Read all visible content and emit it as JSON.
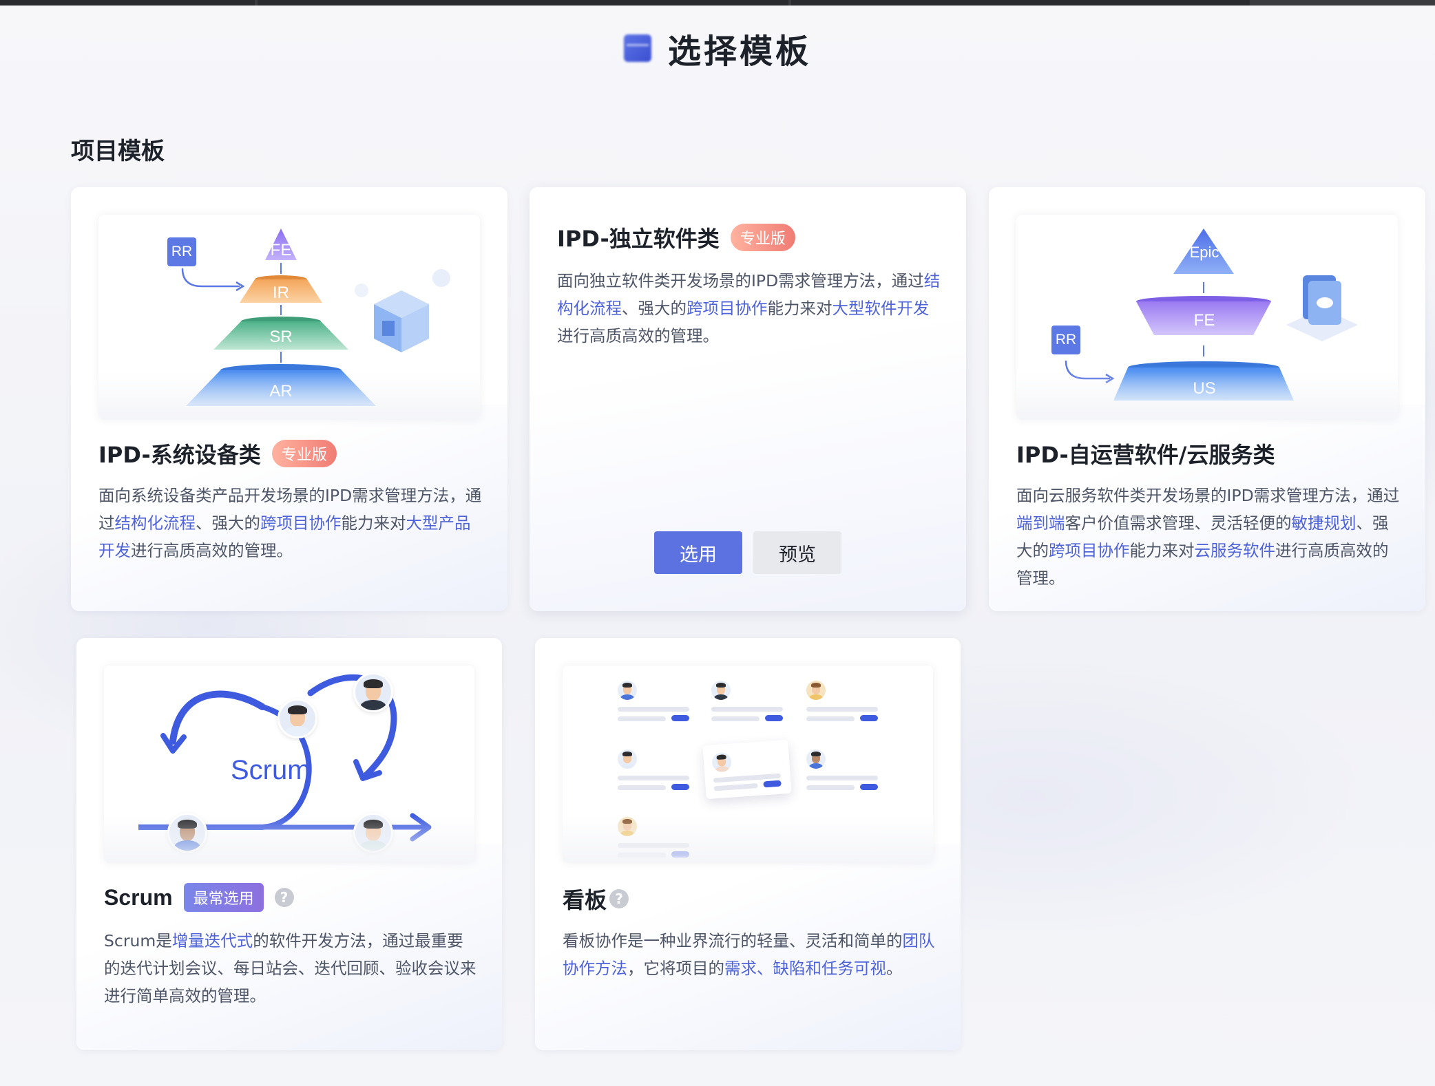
{
  "header": {
    "title": "选择模板",
    "icon": "template-icon"
  },
  "section": {
    "title": "项目模板"
  },
  "cards": [
    {
      "title": "IPD-系统设备类",
      "badge": "专业版",
      "desc": [
        {
          "t": "面向系统设备类产品开发场景的IPD需求管理方法，通过",
          "h": false
        },
        {
          "t": "结构化流程",
          "h": true
        },
        {
          "t": "、强大的",
          "h": false
        },
        {
          "t": "跨项目协作",
          "h": true
        },
        {
          "t": "能力来对",
          "h": false
        },
        {
          "t": "大型产品开发",
          "h": true
        },
        {
          "t": "进行高质高效的管理。",
          "h": false
        }
      ],
      "art": {
        "rr": "RR",
        "fe": "FE",
        "ir": "IR",
        "sr": "SR",
        "ar": "AR"
      }
    },
    {
      "title": "IPD-独立软件类",
      "badge": "专业版",
      "desc": [
        {
          "t": "面向独立软件类开发场景的IPD需求管理方法，通过",
          "h": false
        },
        {
          "t": "结构化流程",
          "h": true
        },
        {
          "t": "、强大的",
          "h": false
        },
        {
          "t": "跨项目协作",
          "h": true
        },
        {
          "t": "能力来对",
          "h": false
        },
        {
          "t": "大型软件开发",
          "h": true
        },
        {
          "t": "进行高质高效的管理。",
          "h": false
        }
      ],
      "buttons": {
        "select": "选用",
        "preview": "预览"
      }
    },
    {
      "title": "IPD-自运营软件/云服务类",
      "desc": [
        {
          "t": "面向云服务软件类开发场景的IPD需求管理方法，通过",
          "h": false
        },
        {
          "t": "端到端",
          "h": true
        },
        {
          "t": "客户价值需求管理、灵活轻便的",
          "h": false
        },
        {
          "t": "敏捷规划",
          "h": true
        },
        {
          "t": "、强大的",
          "h": false
        },
        {
          "t": "跨项目协作",
          "h": true
        },
        {
          "t": "能力来对",
          "h": false
        },
        {
          "t": "云服务软件",
          "h": true
        },
        {
          "t": "进行高质高效的管理。",
          "h": false
        }
      ],
      "art": {
        "epic": "Epic",
        "fe": "FE",
        "us": "US",
        "rr": "RR"
      }
    },
    {
      "title": "Scrum",
      "badge": "最常选用",
      "desc": [
        {
          "t": "Scrum是",
          "h": false
        },
        {
          "t": "增量迭代式",
          "h": true
        },
        {
          "t": "的软件开发方法，通过最重要的迭代计划会议、每日站会、迭代回顾、验收会议来进行简单高效的管理。",
          "h": false
        }
      ],
      "art": {
        "label": "Scrum"
      }
    },
    {
      "title": "看板",
      "desc": [
        {
          "t": "看板协作是一种业界流行的轻量、灵活和简单的",
          "h": false
        },
        {
          "t": "团队协作方法",
          "h": true
        },
        {
          "t": "，它将项目的",
          "h": false
        },
        {
          "t": "需求、缺陷和任务可视",
          "h": true
        },
        {
          "t": "。",
          "h": false
        }
      ]
    }
  ],
  "colors": {
    "accent": "#5b72e0",
    "highlight": "#4f63d8",
    "pro_badge": "#f07c74",
    "common_badge": "#7a86e8"
  }
}
